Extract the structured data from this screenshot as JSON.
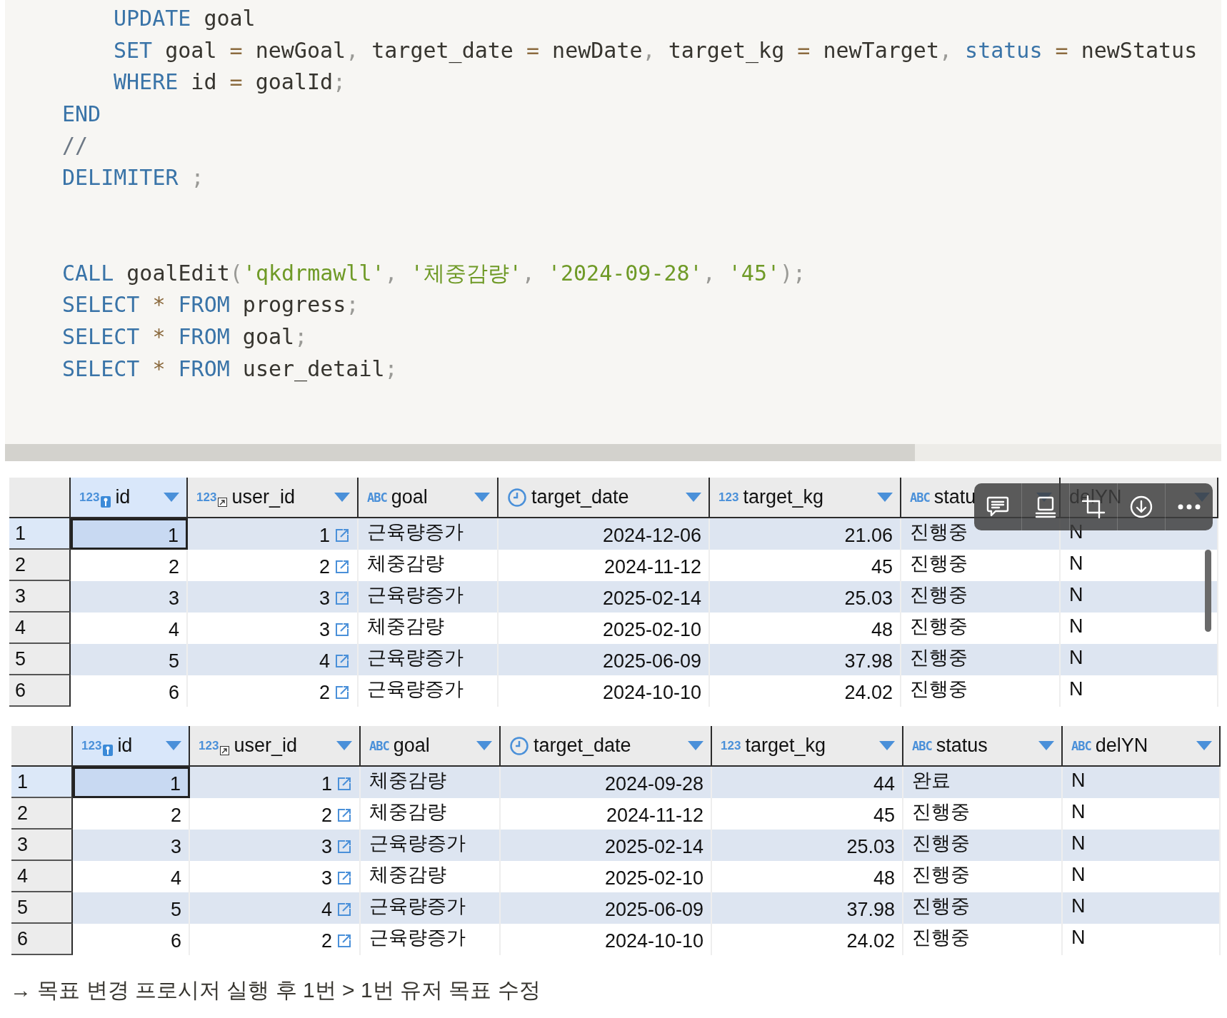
{
  "code": {
    "lines": [
      {
        "kind": "code",
        "indented": true,
        "tokens": [
          {
            "kind": "keyword",
            "text": "UPDATE"
          },
          {
            "kind": "ident",
            "text": " goal"
          }
        ]
      },
      {
        "kind": "code",
        "indented": true,
        "tokens": [
          {
            "kind": "keyword",
            "text": "SET"
          },
          {
            "kind": "ident",
            "text": " goal "
          },
          {
            "kind": "operator",
            "text": "="
          },
          {
            "kind": "ident",
            "text": " newGoal"
          },
          {
            "kind": "punct",
            "text": ","
          },
          {
            "kind": "ident",
            "text": " target_date "
          },
          {
            "kind": "operator",
            "text": "="
          },
          {
            "kind": "ident",
            "text": " newDate"
          },
          {
            "kind": "punct",
            "text": ","
          },
          {
            "kind": "ident",
            "text": " target_kg "
          },
          {
            "kind": "operator",
            "text": "="
          },
          {
            "kind": "ident",
            "text": " newTarget"
          },
          {
            "kind": "punct",
            "text": ","
          },
          {
            "kind": "keyword",
            "text": " status "
          },
          {
            "kind": "operator",
            "text": "="
          },
          {
            "kind": "ident",
            "text": " newStatus"
          }
        ]
      },
      {
        "kind": "code",
        "indented": true,
        "tokens": [
          {
            "kind": "keyword",
            "text": "WHERE"
          },
          {
            "kind": "ident",
            "text": " id "
          },
          {
            "kind": "operator",
            "text": "="
          },
          {
            "kind": "ident",
            "text": " goalId"
          },
          {
            "kind": "punct",
            "text": ";"
          }
        ]
      },
      {
        "kind": "code",
        "indented": false,
        "tokens": [
          {
            "kind": "keyword",
            "text": "END"
          }
        ]
      },
      {
        "kind": "code",
        "indented": false,
        "tokens": [
          {
            "kind": "comment",
            "text": "//"
          }
        ]
      },
      {
        "kind": "code",
        "indented": false,
        "tokens": [
          {
            "kind": "keyword",
            "text": "DELIMITER"
          },
          {
            "kind": "punct",
            "text": " ;"
          }
        ]
      },
      {
        "kind": "blank"
      },
      {
        "kind": "blank"
      },
      {
        "kind": "code",
        "indented": false,
        "tokens": [
          {
            "kind": "keyword",
            "text": "CALL"
          },
          {
            "kind": "ident",
            "text": " goalEdit"
          },
          {
            "kind": "punct",
            "text": "("
          },
          {
            "kind": "string",
            "text": "'qkdrmawll'"
          },
          {
            "kind": "punct",
            "text": ", "
          },
          {
            "kind": "string",
            "text": "'체중감량'"
          },
          {
            "kind": "punct",
            "text": ", "
          },
          {
            "kind": "string",
            "text": "'2024-09-28'"
          },
          {
            "kind": "punct",
            "text": ", "
          },
          {
            "kind": "string",
            "text": "'45'"
          },
          {
            "kind": "punct",
            "text": ");"
          }
        ]
      },
      {
        "kind": "code",
        "indented": false,
        "tokens": [
          {
            "kind": "keyword",
            "text": "SELECT "
          },
          {
            "kind": "operator",
            "text": "*"
          },
          {
            "kind": "keyword",
            "text": " FROM"
          },
          {
            "kind": "ident",
            "text": " progress"
          },
          {
            "kind": "punct",
            "text": ";"
          }
        ]
      },
      {
        "kind": "code",
        "indented": false,
        "tokens": [
          {
            "kind": "keyword",
            "text": "SELECT "
          },
          {
            "kind": "operator",
            "text": "*"
          },
          {
            "kind": "keyword",
            "text": " FROM"
          },
          {
            "kind": "ident",
            "text": " goal"
          },
          {
            "kind": "punct",
            "text": ";"
          }
        ]
      },
      {
        "kind": "code",
        "indented": false,
        "tokens": [
          {
            "kind": "keyword",
            "text": "SELECT "
          },
          {
            "kind": "operator",
            "text": "*"
          },
          {
            "kind": "keyword",
            "text": " FROM"
          },
          {
            "kind": "ident",
            "text": " user_detail"
          },
          {
            "kind": "punct",
            "text": ";"
          }
        ]
      }
    ]
  },
  "result_grids": [
    {
      "columns": [
        {
          "label": "id",
          "kind": "primary_key",
          "badge": "123",
          "selected": true
        },
        {
          "label": "user_id",
          "kind": "foreign_key",
          "badge": "123",
          "selected": false
        },
        {
          "label": "goal",
          "kind": "text",
          "badge": "ABC",
          "selected": false
        },
        {
          "label": "target_date",
          "kind": "date",
          "selected": false
        },
        {
          "label": "target_kg",
          "kind": "number",
          "badge": "123",
          "selected": false
        },
        {
          "label": "statu",
          "kind": "text",
          "badge": "ABC",
          "selected": false
        },
        {
          "label": "delYN",
          "kind": "text",
          "selected": false
        }
      ],
      "rows": [
        {
          "number": "1",
          "selected": true,
          "cells": [
            "1",
            "1",
            "근육량증가",
            "2024-12-06",
            "21.06",
            "진행중",
            "N"
          ]
        },
        {
          "number": "2",
          "selected": false,
          "cells": [
            "2",
            "2",
            "체중감량",
            "2024-11-12",
            "45",
            "진행중",
            "N"
          ]
        },
        {
          "number": "3",
          "selected": false,
          "cells": [
            "3",
            "3",
            "근육량증가",
            "2025-02-14",
            "25.03",
            "진행중",
            "N"
          ]
        },
        {
          "number": "4",
          "selected": false,
          "cells": [
            "4",
            "3",
            "체중감량",
            "2025-02-10",
            "48",
            "진행중",
            "N"
          ]
        },
        {
          "number": "5",
          "selected": false,
          "cells": [
            "5",
            "4",
            "근육량증가",
            "2025-06-09",
            "37.98",
            "진행중",
            "N"
          ]
        },
        {
          "number": "6",
          "selected": false,
          "cells": [
            "6",
            "2",
            "근육량증가",
            "2024-10-10",
            "24.02",
            "진행중",
            "N"
          ]
        }
      ],
      "markup_toolbar": {
        "items": [
          {
            "kind": "comment"
          },
          {
            "kind": "caption"
          },
          {
            "kind": "crop"
          },
          {
            "kind": "download"
          },
          {
            "kind": "more"
          }
        ]
      }
    },
    {
      "columns": [
        {
          "label": "id",
          "kind": "primary_key",
          "badge": "123",
          "selected": true
        },
        {
          "label": "user_id",
          "kind": "foreign_key",
          "badge": "123",
          "selected": false
        },
        {
          "label": "goal",
          "kind": "text",
          "badge": "ABC",
          "selected": false
        },
        {
          "label": "target_date",
          "kind": "date",
          "selected": false
        },
        {
          "label": "target_kg",
          "kind": "number",
          "badge": "123",
          "selected": false
        },
        {
          "label": "status",
          "kind": "text",
          "badge": "ABC",
          "selected": false
        },
        {
          "label": "delYN",
          "kind": "text",
          "badge": "ABC",
          "selected": false
        }
      ],
      "rows": [
        {
          "number": "1",
          "selected": true,
          "cells": [
            "1",
            "1",
            "체중감량",
            "2024-09-28",
            "44",
            "완료",
            "N"
          ]
        },
        {
          "number": "2",
          "selected": false,
          "cells": [
            "2",
            "2",
            "체중감량",
            "2024-11-12",
            "45",
            "진행중",
            "N"
          ]
        },
        {
          "number": "3",
          "selected": false,
          "cells": [
            "3",
            "3",
            "근육량증가",
            "2025-02-14",
            "25.03",
            "진행중",
            "N"
          ]
        },
        {
          "number": "4",
          "selected": false,
          "cells": [
            "4",
            "3",
            "체중감량",
            "2025-02-10",
            "48",
            "진행중",
            "N"
          ]
        },
        {
          "number": "5",
          "selected": false,
          "cells": [
            "5",
            "4",
            "근육량증가",
            "2025-06-09",
            "37.98",
            "진행중",
            "N"
          ]
        },
        {
          "number": "6",
          "selected": false,
          "cells": [
            "6",
            "2",
            "근육량증가",
            "2024-10-10",
            "24.02",
            "진행중",
            "N"
          ]
        }
      ]
    }
  ],
  "caption": "→ 목표 변경 프로시저 실행 후 1번 > 1번 유저 목표 수정"
}
